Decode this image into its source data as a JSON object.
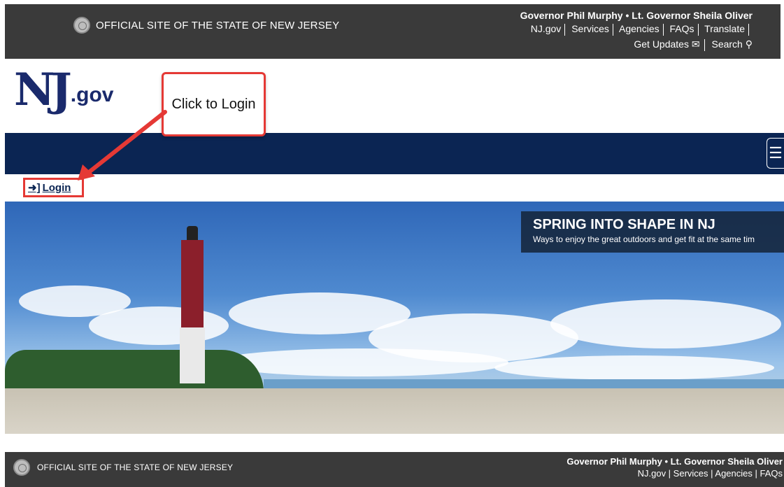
{
  "topbar": {
    "official_text": "OFFICIAL SITE OF THE STATE OF NEW JERSEY",
    "governor_line": "Governor Phil Murphy • Lt. Governor Sheila Oliver",
    "links": [
      "NJ.gov",
      "Services",
      "Agencies",
      "FAQs",
      "Translate"
    ],
    "get_updates": "Get Updates",
    "search": "Search"
  },
  "logo": {
    "nj": "NJ",
    "gov": ".gov"
  },
  "callout": {
    "text": "Click to Login"
  },
  "login": {
    "label": "Login"
  },
  "hero": {
    "title": "SPRING INTO SHAPE IN NJ",
    "subtitle": "Ways to enjoy the great outdoors and get fit at the same tim"
  },
  "footer": {
    "official_text": "OFFICIAL SITE OF THE STATE OF NEW JERSEY",
    "governor_line": "Governor Phil Murphy • Lt. Governor Sheila Oliver",
    "links_text": "NJ.gov | Services | Agencies | FAQs"
  },
  "colors": {
    "navy": "#0b2553",
    "annotation_red": "#e53935",
    "dark_bar": "#3a3a3a"
  }
}
